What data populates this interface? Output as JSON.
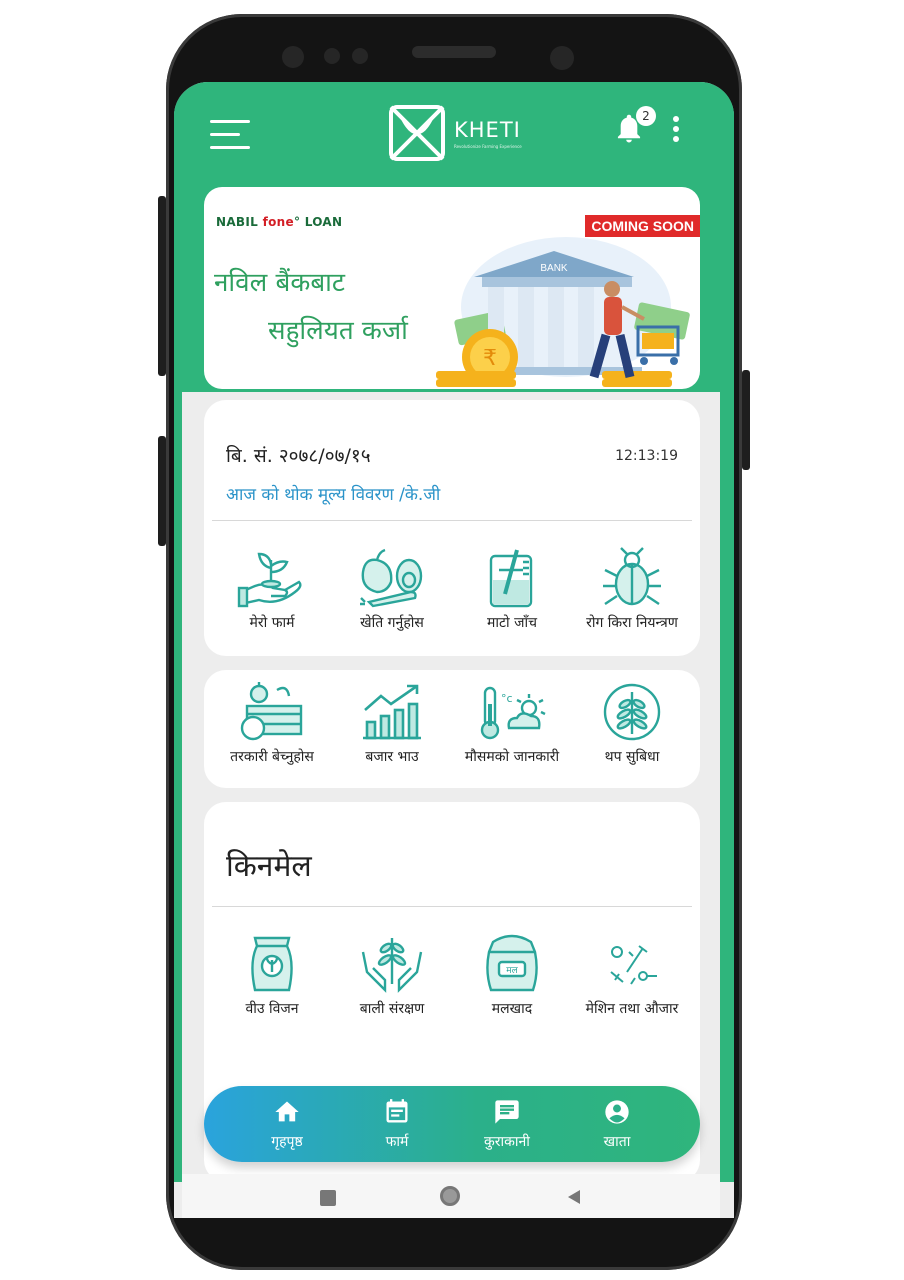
{
  "app": {
    "logo_text": "KHETI",
    "logo_tagline": "Revolutionize Farming Experience",
    "notification_count": "2"
  },
  "banner": {
    "brand_prefix": "NABIL ",
    "brand_fone": "fone",
    "brand_suffix": "° LOAN",
    "tag": "COMING SOON",
    "line1": "नविल बैंकबाट",
    "line2": "सहुलियत कर्जा",
    "bank_sign": "BANK"
  },
  "info": {
    "date": "बि. सं. २०७८/०७/१५",
    "time": "12:13:19",
    "rate_link": "आज को थोक मूल्य विवरण /के.जी"
  },
  "services": [
    {
      "label": "मेरो फार्म",
      "icon": "hand-plant-icon"
    },
    {
      "label": "खेति गर्नुहोस",
      "icon": "fruits-vegetables-icon"
    },
    {
      "label": "माटो जाँच",
      "icon": "soil-test-beaker-icon"
    },
    {
      "label": "रोग किरा नियन्त्रण",
      "icon": "bug-icon"
    }
  ],
  "services2": [
    {
      "label": "तरकारी बेच्नुहोस",
      "icon": "vegetable-basket-icon"
    },
    {
      "label": "बजार भाउ",
      "icon": "market-chart-icon"
    },
    {
      "label": "मौसमको जानकारी",
      "icon": "weather-thermometer-icon"
    },
    {
      "label": "थप सुबिधा",
      "icon": "wheat-circle-icon"
    }
  ],
  "shop": {
    "title": "किनमेल",
    "items": [
      {
        "label": "वीउ विजन",
        "icon": "seed-bag-icon"
      },
      {
        "label": "बाली संरक्षण",
        "icon": "hands-plant-icon"
      },
      {
        "label": "मलखाद",
        "icon": "fertilizer-bag-icon"
      },
      {
        "label": "मेशिन तथा औजार",
        "icon": "tools-icon"
      }
    ]
  },
  "nav": [
    {
      "label": "गृहपृष्ठ",
      "icon": "home-icon"
    },
    {
      "label": "फार्म",
      "icon": "calendar-icon"
    },
    {
      "label": "कुराकानी",
      "icon": "chat-icon"
    },
    {
      "label": "खाता",
      "icon": "account-icon"
    }
  ],
  "colors": {
    "primary": "#2fb57c",
    "link": "#2a93c9",
    "icon_teal": "#2aa59a",
    "alert": "#e02a2a"
  }
}
